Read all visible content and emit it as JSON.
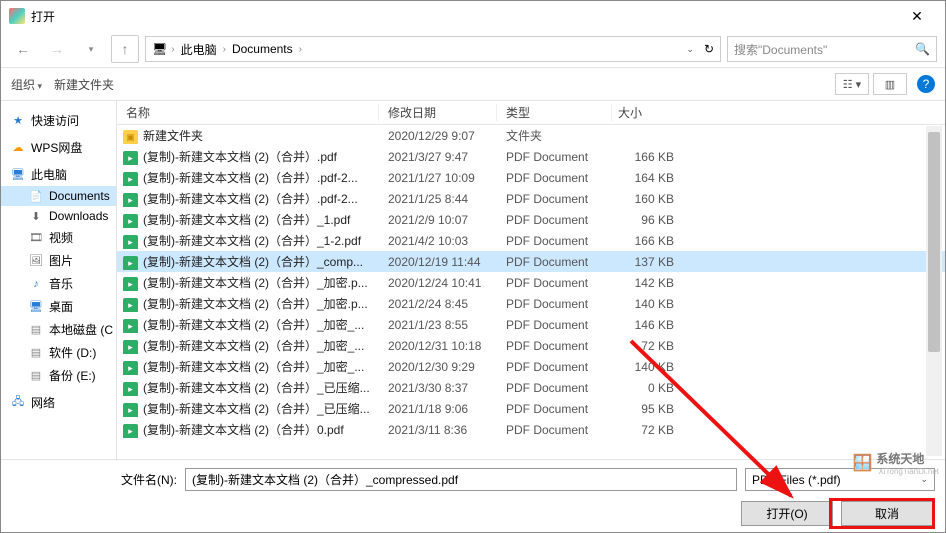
{
  "window": {
    "title": "打开"
  },
  "breadcrumb": {
    "root": "此电脑",
    "segments": [
      "Documents"
    ]
  },
  "search": {
    "placeholder": "搜索\"Documents\""
  },
  "toolbar": {
    "organize": "组织",
    "newfolder": "新建文件夹"
  },
  "sidebar": {
    "quick": "快速访问",
    "wps": "WPS网盘",
    "thispc": "此电脑",
    "documents": "Documents",
    "downloads": "Downloads",
    "videos": "视频",
    "pictures": "图片",
    "music": "音乐",
    "desktop": "桌面",
    "localc": "本地磁盘 (C",
    "driveD": "软件 (D:)",
    "driveE": "备份 (E:)",
    "network": "网络"
  },
  "columns": {
    "name": "名称",
    "date": "修改日期",
    "type": "类型",
    "size": "大小"
  },
  "files": [
    {
      "icon": "folder",
      "name": "新建文件夹",
      "date": "2020/12/29 9:07",
      "type": "文件夹",
      "size": ""
    },
    {
      "icon": "pdf",
      "name": "(复制)-新建文本文档 (2)（合并）.pdf",
      "date": "2021/3/27 9:47",
      "type": "PDF Document",
      "size": "166 KB"
    },
    {
      "icon": "pdf",
      "name": "(复制)-新建文本文档 (2)（合并）.pdf-2...",
      "date": "2021/1/27 10:09",
      "type": "PDF Document",
      "size": "164 KB"
    },
    {
      "icon": "pdf",
      "name": "(复制)-新建文本文档 (2)（合并）.pdf-2...",
      "date": "2021/1/25 8:44",
      "type": "PDF Document",
      "size": "160 KB"
    },
    {
      "icon": "pdf",
      "name": "(复制)-新建文本文档 (2)（合并）_1.pdf",
      "date": "2021/2/9 10:07",
      "type": "PDF Document",
      "size": "96 KB"
    },
    {
      "icon": "pdf",
      "name": "(复制)-新建文本文档 (2)（合并）_1-2.pdf",
      "date": "2021/4/2 10:03",
      "type": "PDF Document",
      "size": "166 KB"
    },
    {
      "icon": "pdf",
      "name": "(复制)-新建文本文档 (2)（合并）_comp...",
      "date": "2020/12/19 11:44",
      "type": "PDF Document",
      "size": "137 KB",
      "selected": true
    },
    {
      "icon": "pdf",
      "name": "(复制)-新建文本文档 (2)（合并）_加密.p...",
      "date": "2020/12/24 10:41",
      "type": "PDF Document",
      "size": "142 KB"
    },
    {
      "icon": "pdf",
      "name": "(复制)-新建文本文档 (2)（合并）_加密.p...",
      "date": "2021/2/24 8:45",
      "type": "PDF Document",
      "size": "140 KB"
    },
    {
      "icon": "pdf",
      "name": "(复制)-新建文本文档 (2)（合并）_加密_...",
      "date": "2021/1/23 8:55",
      "type": "PDF Document",
      "size": "146 KB"
    },
    {
      "icon": "pdf",
      "name": "(复制)-新建文本文档 (2)（合并）_加密_...",
      "date": "2020/12/31 10:18",
      "type": "PDF Document",
      "size": "72 KB"
    },
    {
      "icon": "pdf",
      "name": "(复制)-新建文本文档 (2)（合并）_加密_...",
      "date": "2020/12/30 9:29",
      "type": "PDF Document",
      "size": "140 KB"
    },
    {
      "icon": "pdf",
      "name": "(复制)-新建文本文档 (2)（合并）_已压缩...",
      "date": "2021/3/30 8:37",
      "type": "PDF Document",
      "size": "0 KB"
    },
    {
      "icon": "pdf",
      "name": "(复制)-新建文本文档 (2)（合并）_已压缩...",
      "date": "2021/1/18 9:06",
      "type": "PDF Document",
      "size": "95 KB"
    },
    {
      "icon": "pdf",
      "name": "(复制)-新建文本文档 (2)（合并）0.pdf",
      "date": "2021/3/11 8:36",
      "type": "PDF Document",
      "size": "72 KB"
    }
  ],
  "footer": {
    "filename_label": "文件名(N):",
    "filename_value": "(复制)-新建文本文档 (2)（合并）_compressed.pdf",
    "filter": "PDF Files (*.pdf)",
    "open_btn": "打开(O)",
    "cancel_btn": "取消"
  },
  "watermark": {
    "main": "系统天地",
    "sub": "XiTongTianDi.net"
  }
}
